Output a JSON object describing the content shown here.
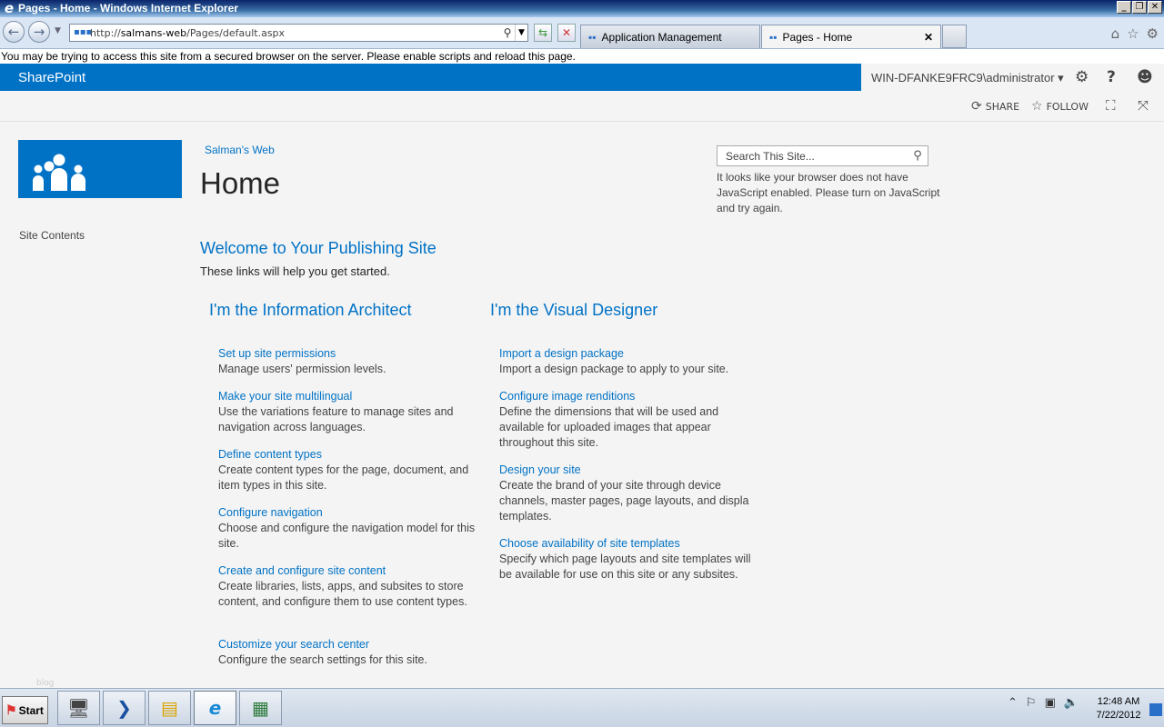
{
  "window": {
    "title": "Pages - Home - Windows Internet Explorer",
    "buttons": {
      "minimize": "_",
      "restore": "❐",
      "close": "✕"
    }
  },
  "browser": {
    "url_prefix": "http://",
    "url_host": "salmans-web",
    "url_path": "/Pages/default.aspx",
    "tabs": [
      {
        "label": "Application Management",
        "active": false
      },
      {
        "label": "Pages - Home",
        "active": true
      }
    ],
    "tab_close": "✕"
  },
  "warning": {
    "text": "You may be trying to access this site from a secured browser on the server. Please enable scripts and reload this page."
  },
  "suitebar": {
    "brand": "SharePoint",
    "user": "WIN-DFANKE9FRC9\\administrator",
    "user_dropdown": "▾",
    "help": "?"
  },
  "ribbon": {
    "share_label": "SHARE",
    "follow_label": "FOLLOW"
  },
  "site": {
    "breadcrumb": "Salman's Web",
    "title": "Home",
    "nav_site_contents": "Site Contents",
    "search_placeholder": "Search This Site...",
    "js_note": "It looks like your browser does not have JavaScript enabled. Please turn on JavaScript and try again."
  },
  "welcome": {
    "heading": "Welcome to Your Publishing Site",
    "subtitle": "These links will help you get started."
  },
  "columns": {
    "architect": {
      "heading": "I'm the Information Architect",
      "items": [
        {
          "link": "Set up site permissions",
          "desc": "Manage users' permission levels."
        },
        {
          "link": "Make your site multilingual",
          "desc": "Use the variations feature to manage sites and navigation across languages."
        },
        {
          "link": "Define content types",
          "desc": "Create content types for the page, document, and item types in this site."
        },
        {
          "link": "Configure navigation",
          "desc": "Choose and configure the navigation model for this site."
        },
        {
          "link": "Create and configure site content",
          "desc": "Create libraries, lists, apps, and subsites to store content, and configure them to use content types."
        },
        {
          "link": "Customize your search center",
          "desc": "Configure the search settings for this site."
        }
      ]
    },
    "designer": {
      "heading": "I'm the Visual Designer",
      "items": [
        {
          "link": "Import a design package",
          "desc": "Import a design package to apply to your site."
        },
        {
          "link": "Configure image renditions",
          "desc": "Define the dimensions that will be used and available for uploaded images that appear throughout this site."
        },
        {
          "link": "Design your site",
          "desc": "Create the brand of your site through device channels, master pages, page layouts, and displa templates."
        },
        {
          "link": "Choose availability of site templates",
          "desc": "Specify which page layouts and site templates will be available for use on this site or any subsites."
        }
      ]
    }
  },
  "footer_faint": "blog",
  "taskbar": {
    "start_label": "Start",
    "clock_time": "12:48 AM",
    "clock_date": "7/22/2012"
  },
  "colors": {
    "sharepoint_blue": "#0072c6",
    "page_bg": "#f4f4f4",
    "text": "#444444"
  }
}
